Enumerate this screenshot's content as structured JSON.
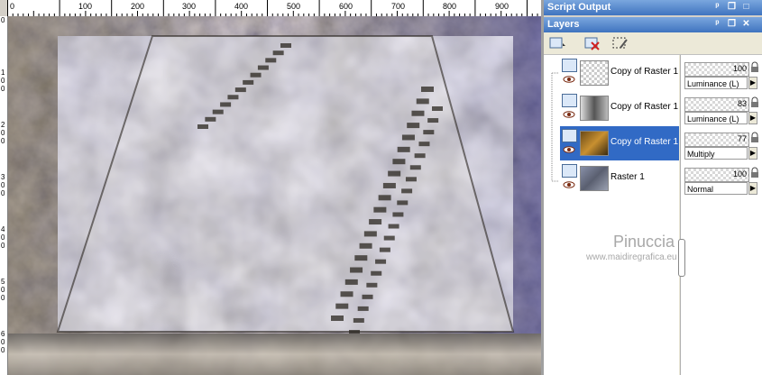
{
  "ruler": {
    "h_labels": [
      "0",
      "100",
      "200",
      "300",
      "400",
      "500",
      "600",
      "700",
      "800",
      "900"
    ],
    "v_labels": [
      "0",
      "100",
      "200",
      "300",
      "400",
      "500",
      "600"
    ]
  },
  "script_panel": {
    "title": "Script Output"
  },
  "layers_panel": {
    "title": "Layers",
    "layers": [
      {
        "name": "Copy of Raster 1",
        "opacity": "100",
        "blend": "Luminance (L)",
        "selected": false
      },
      {
        "name": "Copy of Raster 1",
        "opacity": "83",
        "blend": "Luminance (L)",
        "selected": false
      },
      {
        "name": "Copy of Raster 1",
        "opacity": "77",
        "blend": "Multiply",
        "selected": true
      },
      {
        "name": "Raster 1",
        "opacity": "100",
        "blend": "Normal",
        "selected": false
      }
    ]
  },
  "watermark": {
    "name": "Pinuccia",
    "site": "www.maidiregrafica.eu"
  },
  "colors": {
    "title_bar": "#3f73bf",
    "selection": "#316ac5"
  }
}
